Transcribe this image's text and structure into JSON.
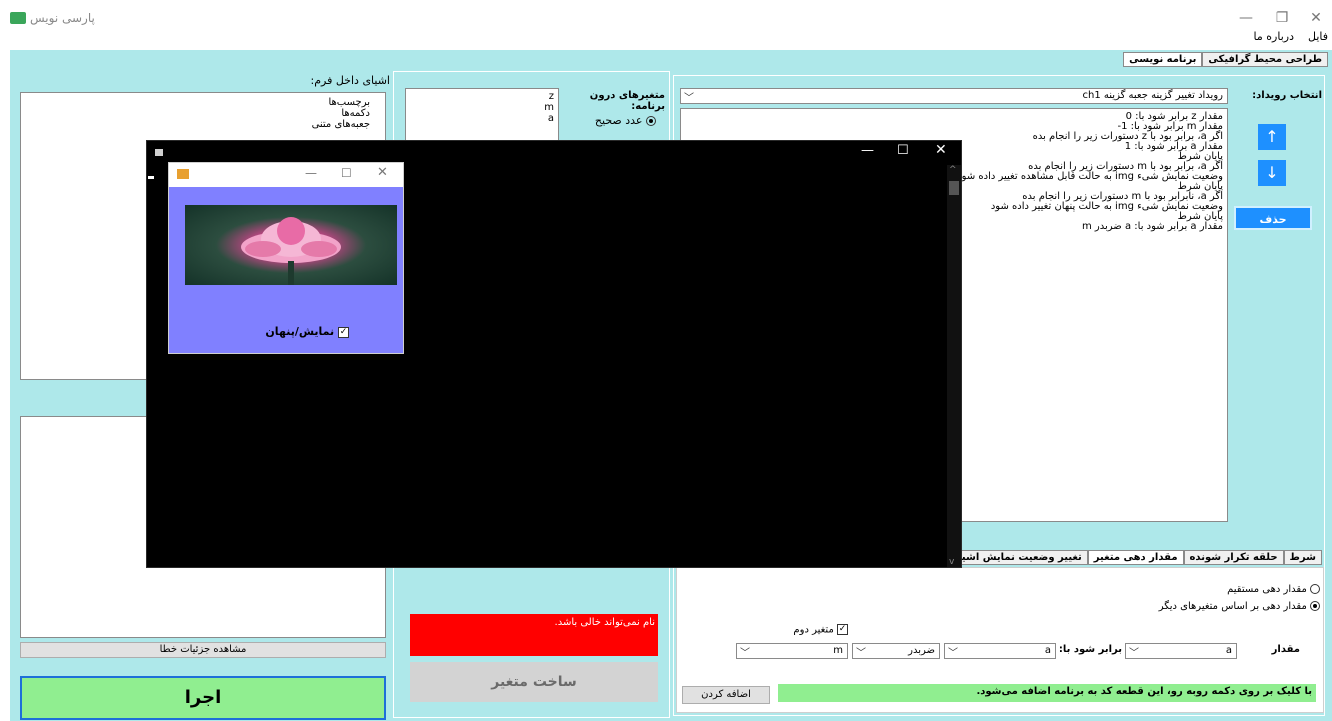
{
  "window": {
    "title": "پارسی نویس"
  },
  "menu": [
    "فایل",
    "درباره ما"
  ],
  "tabs_top": [
    {
      "label": "برنامه نویسی",
      "active": true
    },
    {
      "label": "طراحی محیط گرافیکی",
      "active": false
    }
  ],
  "left": {
    "objects_label": "اشیای داخل فرم:",
    "tree": [
      "برچسب‌ها",
      "دکمه‌ها",
      "جعبه‌های متنی"
    ],
    "error_details_btn": "مشاهده جزئیات خطا",
    "run_btn": "اجرا"
  },
  "vars": {
    "label": "متغیرهای درون برنامه:",
    "list": [
      "z",
      "m",
      "a"
    ],
    "type_integer": "عدد صحیح",
    "error_msg": "نام نمی‌تواند خالی باشد.",
    "make_var_btn": "ساخت متغیر"
  },
  "event": {
    "label": "انتخاب رویداد:",
    "selected": "رویداد تغییر گزینه جعبه گزینه ch1",
    "code_lines": [
      "مقدار z برابر شود با: 0",
      "مقدار m برابر شود با: 1-",
      "اگر a، برابر بود با z دستورات زیر را انجام بده",
      "مقدار a برابر شود با: 1",
      "پایان شرط",
      "اگر a، برابر بود با m دستورات زیر را انجام بده",
      "وضعیت نمایش شیء img به حالت قابل مشاهده تغییر داده شود",
      "پایان شرط",
      "اگر a، نابرابر بود با m دستورات زیر را انجام بده",
      "وضعیت نمایش شیء img به حالت پنهان تغییر داده شود",
      "پایان شرط",
      "مقدار a برابر شود با: a ضربدر m"
    ],
    "delete_btn": "حذف"
  },
  "bottom_tabs": [
    {
      "label": "شرط",
      "active": false
    },
    {
      "label": "حلقه تکرار شونده",
      "active": false
    },
    {
      "label": "مقدار دهی متغیر",
      "active": true
    },
    {
      "label": "تغییر وضعیت نمایش اشیا",
      "active": false
    }
  ],
  "assign": {
    "radio_direct": "مقدار دهی مستقیم",
    "radio_based": "مقدار دهی بر اساس متغیرهای دیگر",
    "second_var": "متغیر دوم",
    "value_label": "مقدار",
    "var1": "a",
    "equals_label": "برابر شود با:",
    "var2": "a",
    "operator": "ضربدر",
    "var3": "m",
    "add_btn": "اضافه کردن",
    "hint": "با کلیک بر روی دکمه روبه رو، این قطعه کد به برنامه اضافه می‌شود."
  },
  "preview": {
    "checkbox_label": "نمایش/پنهان"
  },
  "colors": {
    "app_bg": "#aee8ea",
    "run_btn": "#90ee90",
    "error_bg": "#ff0000",
    "hint_bg": "#90ee90",
    "preview_bg": "#8080ff",
    "console_bg": "#000000",
    "accent_btn": "#1e90ff"
  }
}
